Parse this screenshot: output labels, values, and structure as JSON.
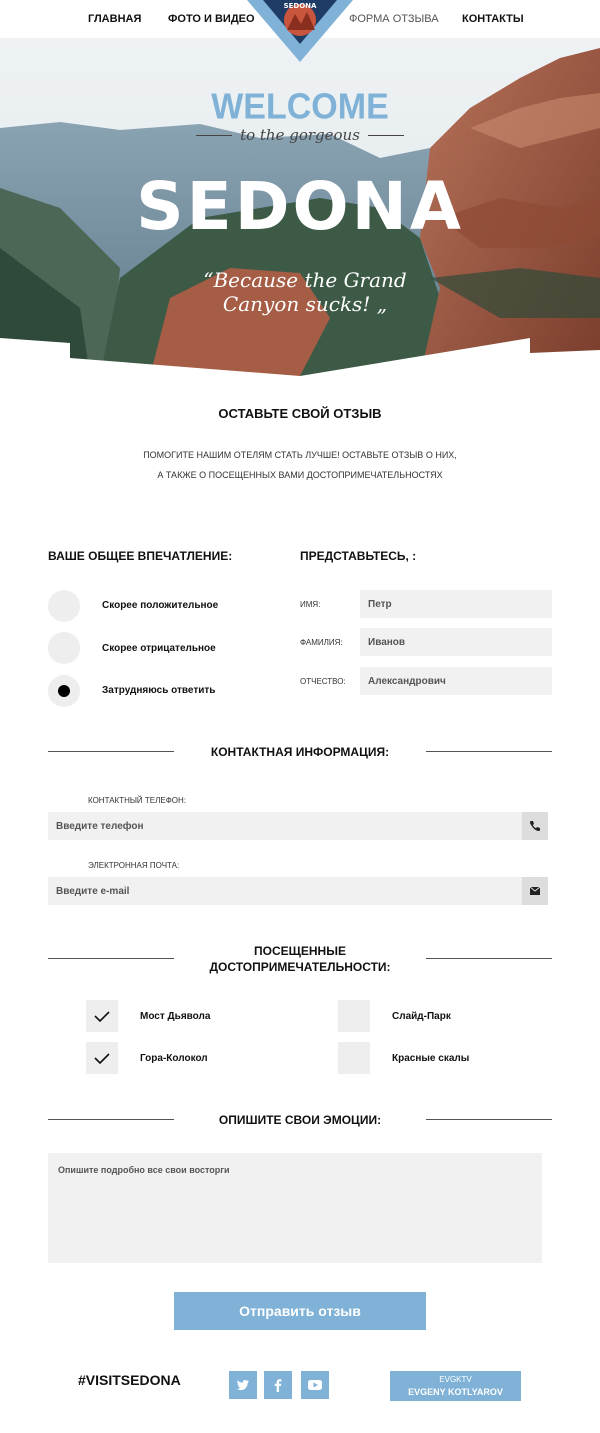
{
  "nav": {
    "items": [
      "Главная",
      "Фото и видео",
      "Форма отзыва",
      "Контакты"
    ],
    "badge_text": "CITY OF SEDONA"
  },
  "hero": {
    "welcome": "WELCOME",
    "tagline": "to the gorgeous",
    "title": "SEDONA",
    "quote_line1": "“Because the Grand",
    "quote_line2": "Canyon sucks! „"
  },
  "review": {
    "heading": "Оставьте свой отзыв",
    "subtext": "Помогите нашим отелям стать лучше! Оставьте отзыв о них, а также о посещенных вами достопримечательностях"
  },
  "impression": {
    "title": "Ваше общее впечатление:",
    "options": [
      {
        "label": "Скорее положительное",
        "selected": false
      },
      {
        "label": "Скорее отрицательное",
        "selected": false
      },
      {
        "label": "Затрудняюсь ответить",
        "selected": true
      }
    ]
  },
  "identity": {
    "title": "Представьтесь, :",
    "fields": [
      {
        "label": "Имя:",
        "value": "Петр"
      },
      {
        "label": "Фамилия:",
        "value": "Иванов"
      },
      {
        "label": "Отчество:",
        "value": "Александрович"
      }
    ]
  },
  "contact": {
    "title": "Контактная информация:",
    "phone_label": "Контактный телефон:",
    "phone_placeholder": "Введите телефон",
    "email_label": "Электронная почта:",
    "email_placeholder": "Введите e-mail"
  },
  "places": {
    "title_line1": "Посещенные",
    "title_line2": "достопримечательности:",
    "items": [
      {
        "label": "Мост Дьявола",
        "checked": true
      },
      {
        "label": "Слайд-Парк",
        "checked": false
      },
      {
        "label": "Гора-Колокол",
        "checked": true
      },
      {
        "label": "Красные скалы",
        "checked": false
      }
    ]
  },
  "emotions": {
    "title": "Опишите свои эмоции:",
    "placeholder": "Опишите подробно все свои восторги"
  },
  "submit_label": "Отправить отзыв",
  "footer": {
    "hashtag": "#VISITSEDONA",
    "social": [
      "twitter-icon",
      "facebook-icon",
      "youtube-icon"
    ],
    "credit_top": "EVGKTV",
    "credit_name": "EVGENY KOTLYAROV"
  },
  "colors": {
    "accent": "#7fb2d6",
    "field_bg": "#f1f1f1"
  }
}
